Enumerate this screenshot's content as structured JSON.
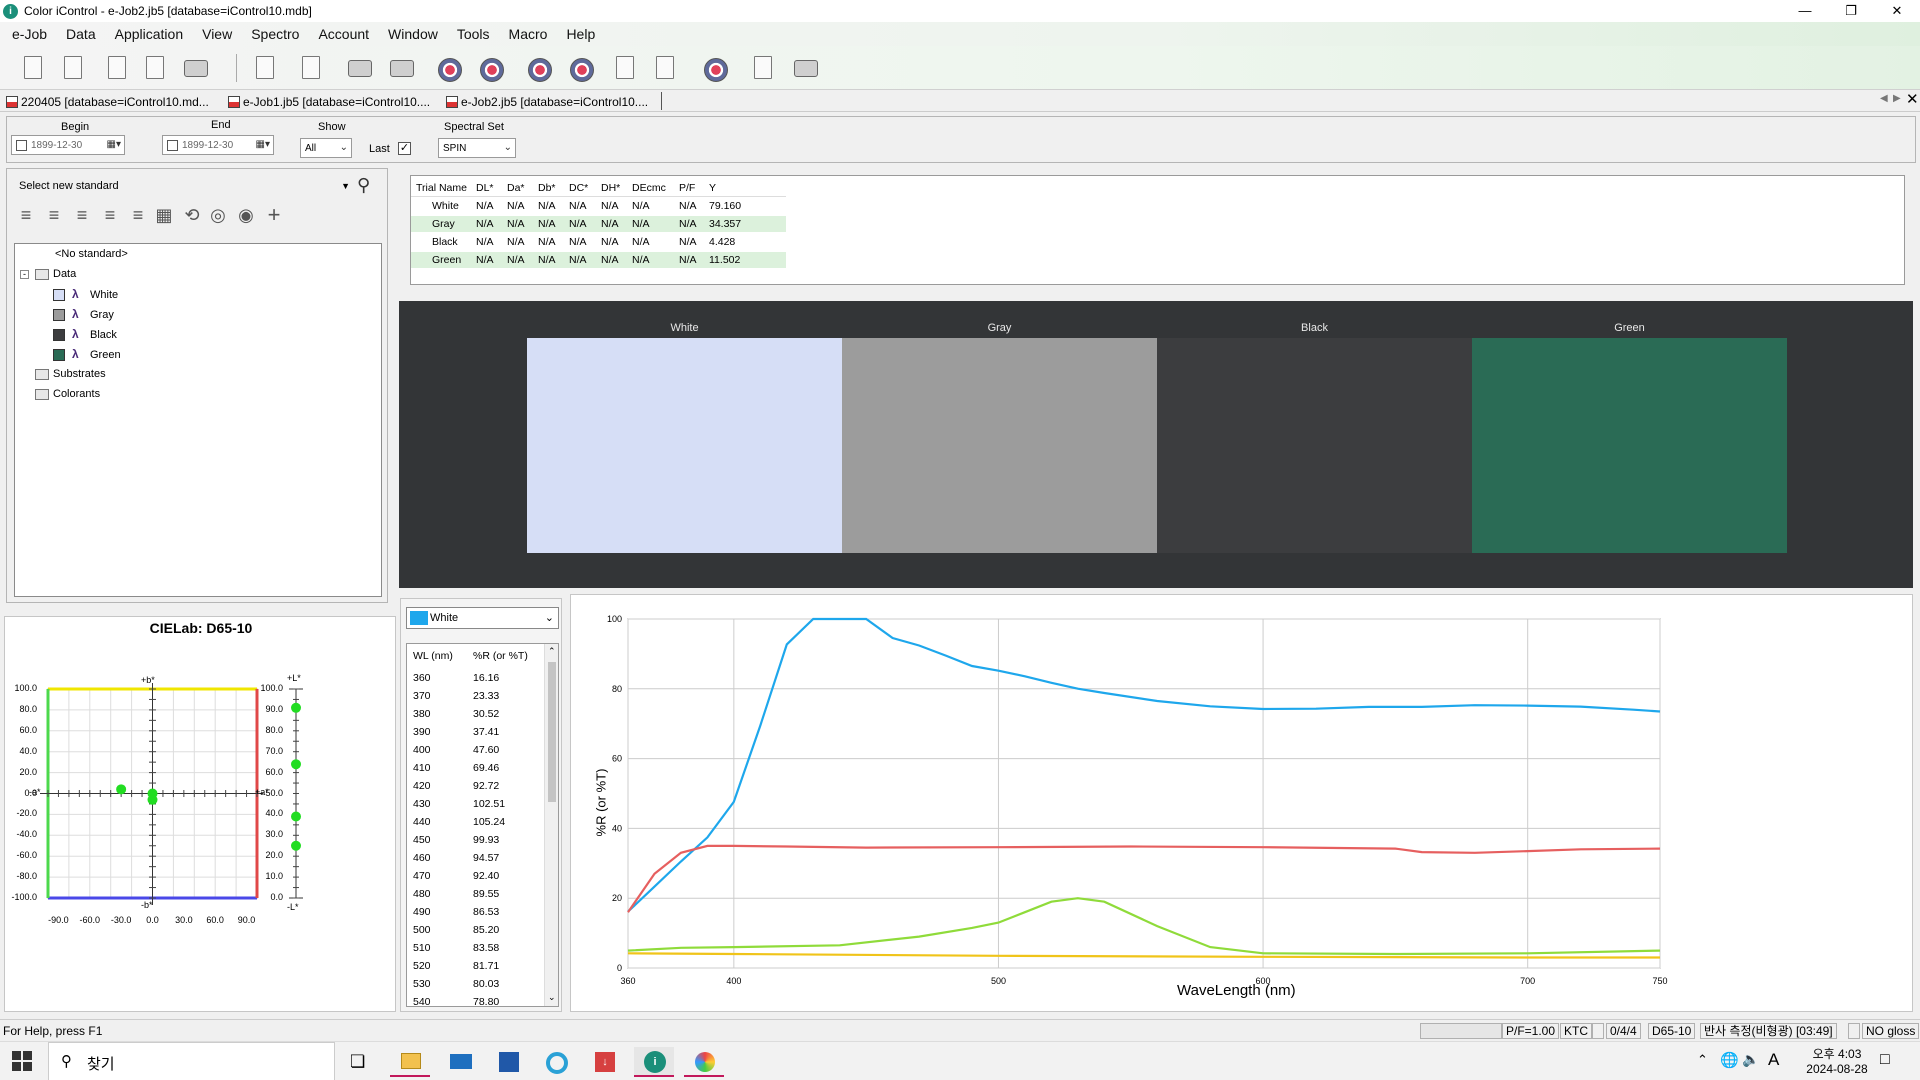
{
  "window": {
    "title": "Color iControl - e-Job2.jb5 [database=iControl10.mdb]",
    "app_icon": "i"
  },
  "menu": [
    "e-Job",
    "Data",
    "Application",
    "View",
    "Spectro",
    "Account",
    "Window",
    "Tools",
    "Macro",
    "Help"
  ],
  "doc_tabs": [
    "220405 [database=iControl10.md...",
    "e-Job1.jb5 [database=iControl10....",
    "e-Job2.jb5 [database=iControl10...."
  ],
  "filters": {
    "begin_label": "Begin",
    "begin_value": "1899-12-30",
    "end_label": "End",
    "end_value": "1899-12-30",
    "show_label": "Show",
    "show_value": "All",
    "last_label": "Last",
    "spectral_label": "Spectral Set",
    "spectral_value": "SPIN"
  },
  "standard": {
    "placeholder": "Select new standard"
  },
  "tree": {
    "no_standard": "<No standard>",
    "data": "Data",
    "items": [
      {
        "label": "White",
        "color": "#d6def6"
      },
      {
        "label": "Gray",
        "color": "#9c9c9c"
      },
      {
        "label": "Black",
        "color": "#3c3d3f"
      },
      {
        "label": "Green",
        "color": "#2a6b55"
      }
    ],
    "substrates": "Substrates",
    "colorants": "Colorants"
  },
  "trials": {
    "headers": [
      "Trial Name",
      "DL*",
      "Da*",
      "Db*",
      "DC*",
      "DH*",
      "DEcmc",
      "P/F",
      "Y"
    ],
    "rows": [
      [
        "White",
        "N/A",
        "N/A",
        "N/A",
        "N/A",
        "N/A",
        "N/A",
        "N/A",
        "79.160"
      ],
      [
        "Gray",
        "N/A",
        "N/A",
        "N/A",
        "N/A",
        "N/A",
        "N/A",
        "N/A",
        "34.357"
      ],
      [
        "Black",
        "N/A",
        "N/A",
        "N/A",
        "N/A",
        "N/A",
        "N/A",
        "N/A",
        "4.428"
      ],
      [
        "Green",
        "N/A",
        "N/A",
        "N/A",
        "N/A",
        "N/A",
        "N/A",
        "N/A",
        "11.502"
      ]
    ]
  },
  "swatches": [
    {
      "label": "White",
      "color": "#d6def6"
    },
    {
      "label": "Gray",
      "color": "#9c9c9c"
    },
    {
      "label": "Black",
      "color": "#3c3d3f"
    },
    {
      "label": "Green",
      "color": "#2a6b55"
    }
  ],
  "cielab": {
    "title": "CIELab: D65-10",
    "b_pos": "+b*",
    "b_neg": "-b*",
    "a_pos": "+a*",
    "a_neg": "-a*",
    "l_pos": "+L*",
    "l_neg": "-L*",
    "ab_ticks": [
      "100.0",
      "80.0",
      "60.0",
      "40.0",
      "20.0",
      "0.0",
      "-20.0",
      "-40.0",
      "-60.0",
      "-80.0",
      "-100.0"
    ],
    "a_ticks": [
      "-90.0",
      "-60.0",
      "-30.0",
      "0.0",
      "30.0",
      "60.0",
      "90.0"
    ],
    "l_ticks": [
      "100.0",
      "90.0",
      "80.0",
      "70.0",
      "60.0",
      "50.0",
      "40.0",
      "30.0",
      "20.0",
      "10.0",
      "0.0"
    ],
    "ab_points": [
      {
        "a": -30,
        "b": 4
      },
      {
        "a": 0,
        "b": 0
      },
      {
        "a": 0,
        "b": -6
      }
    ],
    "l_points": [
      91,
      64,
      39,
      25
    ],
    "point_color": "#22dd22"
  },
  "spectral_list": {
    "selected": "White",
    "selected_color": "#1ea7ec",
    "headers": [
      "WL (nm)",
      "%R (or %T)"
    ],
    "rows": [
      [
        "360",
        "16.16"
      ],
      [
        "370",
        "23.33"
      ],
      [
        "380",
        "30.52"
      ],
      [
        "390",
        "37.41"
      ],
      [
        "400",
        "47.60"
      ],
      [
        "410",
        "69.46"
      ],
      [
        "420",
        "92.72"
      ],
      [
        "430",
        "102.51"
      ],
      [
        "440",
        "105.24"
      ],
      [
        "450",
        "99.93"
      ],
      [
        "460",
        "94.57"
      ],
      [
        "470",
        "92.40"
      ],
      [
        "480",
        "89.55"
      ],
      [
        "490",
        "86.53"
      ],
      [
        "500",
        "85.20"
      ],
      [
        "510",
        "83.58"
      ],
      [
        "520",
        "81.71"
      ],
      [
        "530",
        "80.03"
      ],
      [
        "540",
        "78.80"
      ]
    ]
  },
  "chart_data": {
    "type": "line",
    "xlabel": "WaveLength (nm)",
    "ylabel": "%R (or %T)",
    "xlim": [
      360,
      750
    ],
    "ylim": [
      0,
      100
    ],
    "xticks": [
      360,
      400,
      500,
      600,
      700,
      750
    ],
    "yticks": [
      0,
      20,
      40,
      60,
      80,
      100
    ],
    "grid": true,
    "series": [
      {
        "color": "#1ea7ec",
        "x": [
          360,
          370,
          380,
          390,
          400,
          410,
          420,
          430,
          440,
          450,
          460,
          470,
          480,
          490,
          500,
          510,
          520,
          530,
          540,
          560,
          580,
          600,
          620,
          640,
          660,
          680,
          700,
          720,
          740,
          750
        ],
        "y": [
          16.16,
          23.33,
          30.52,
          37.41,
          47.6,
          69.46,
          92.72,
          100,
          100,
          100,
          94.57,
          92.4,
          89.55,
          86.53,
          85.2,
          83.58,
          81.71,
          80.03,
          78.8,
          76.5,
          75.0,
          74.2,
          74.3,
          74.8,
          74.8,
          75.3,
          75.2,
          74.9,
          74.0,
          73.5
        ]
      },
      {
        "color": "#e65f5f",
        "x": [
          360,
          370,
          380,
          390,
          400,
          420,
          450,
          500,
          550,
          600,
          650,
          660,
          680,
          700,
          720,
          750
        ],
        "y": [
          16,
          27,
          33,
          35,
          35,
          34.8,
          34.5,
          34.6,
          34.8,
          34.6,
          34.2,
          33.2,
          33.0,
          33.5,
          34.0,
          34.2
        ]
      },
      {
        "color": "#8fdb3a",
        "x": [
          360,
          380,
          400,
          440,
          470,
          490,
          500,
          510,
          520,
          530,
          540,
          560,
          580,
          600,
          650,
          700,
          750
        ],
        "y": [
          5,
          5.8,
          6,
          6.5,
          9,
          11.5,
          13,
          16,
          19,
          20,
          19,
          12,
          6,
          4.2,
          4.0,
          4.2,
          5
        ]
      },
      {
        "color": "#f0c419",
        "x": [
          360,
          400,
          500,
          600,
          700,
          750
        ],
        "y": [
          4.2,
          4.0,
          3.5,
          3.2,
          3.0,
          3.0
        ]
      }
    ]
  },
  "status": {
    "help": "For Help, press F1",
    "pf": "P/F=1.00",
    "ktc": "KTC",
    "count": "0/4/4",
    "illum": "D65-10",
    "measure": "반사 측정(비형광) [03:49]",
    "gloss": "NO gloss"
  },
  "taskbar": {
    "search_label": "찾기",
    "ime": "A",
    "time": "오후 4:03",
    "date": "2024-08-28"
  }
}
